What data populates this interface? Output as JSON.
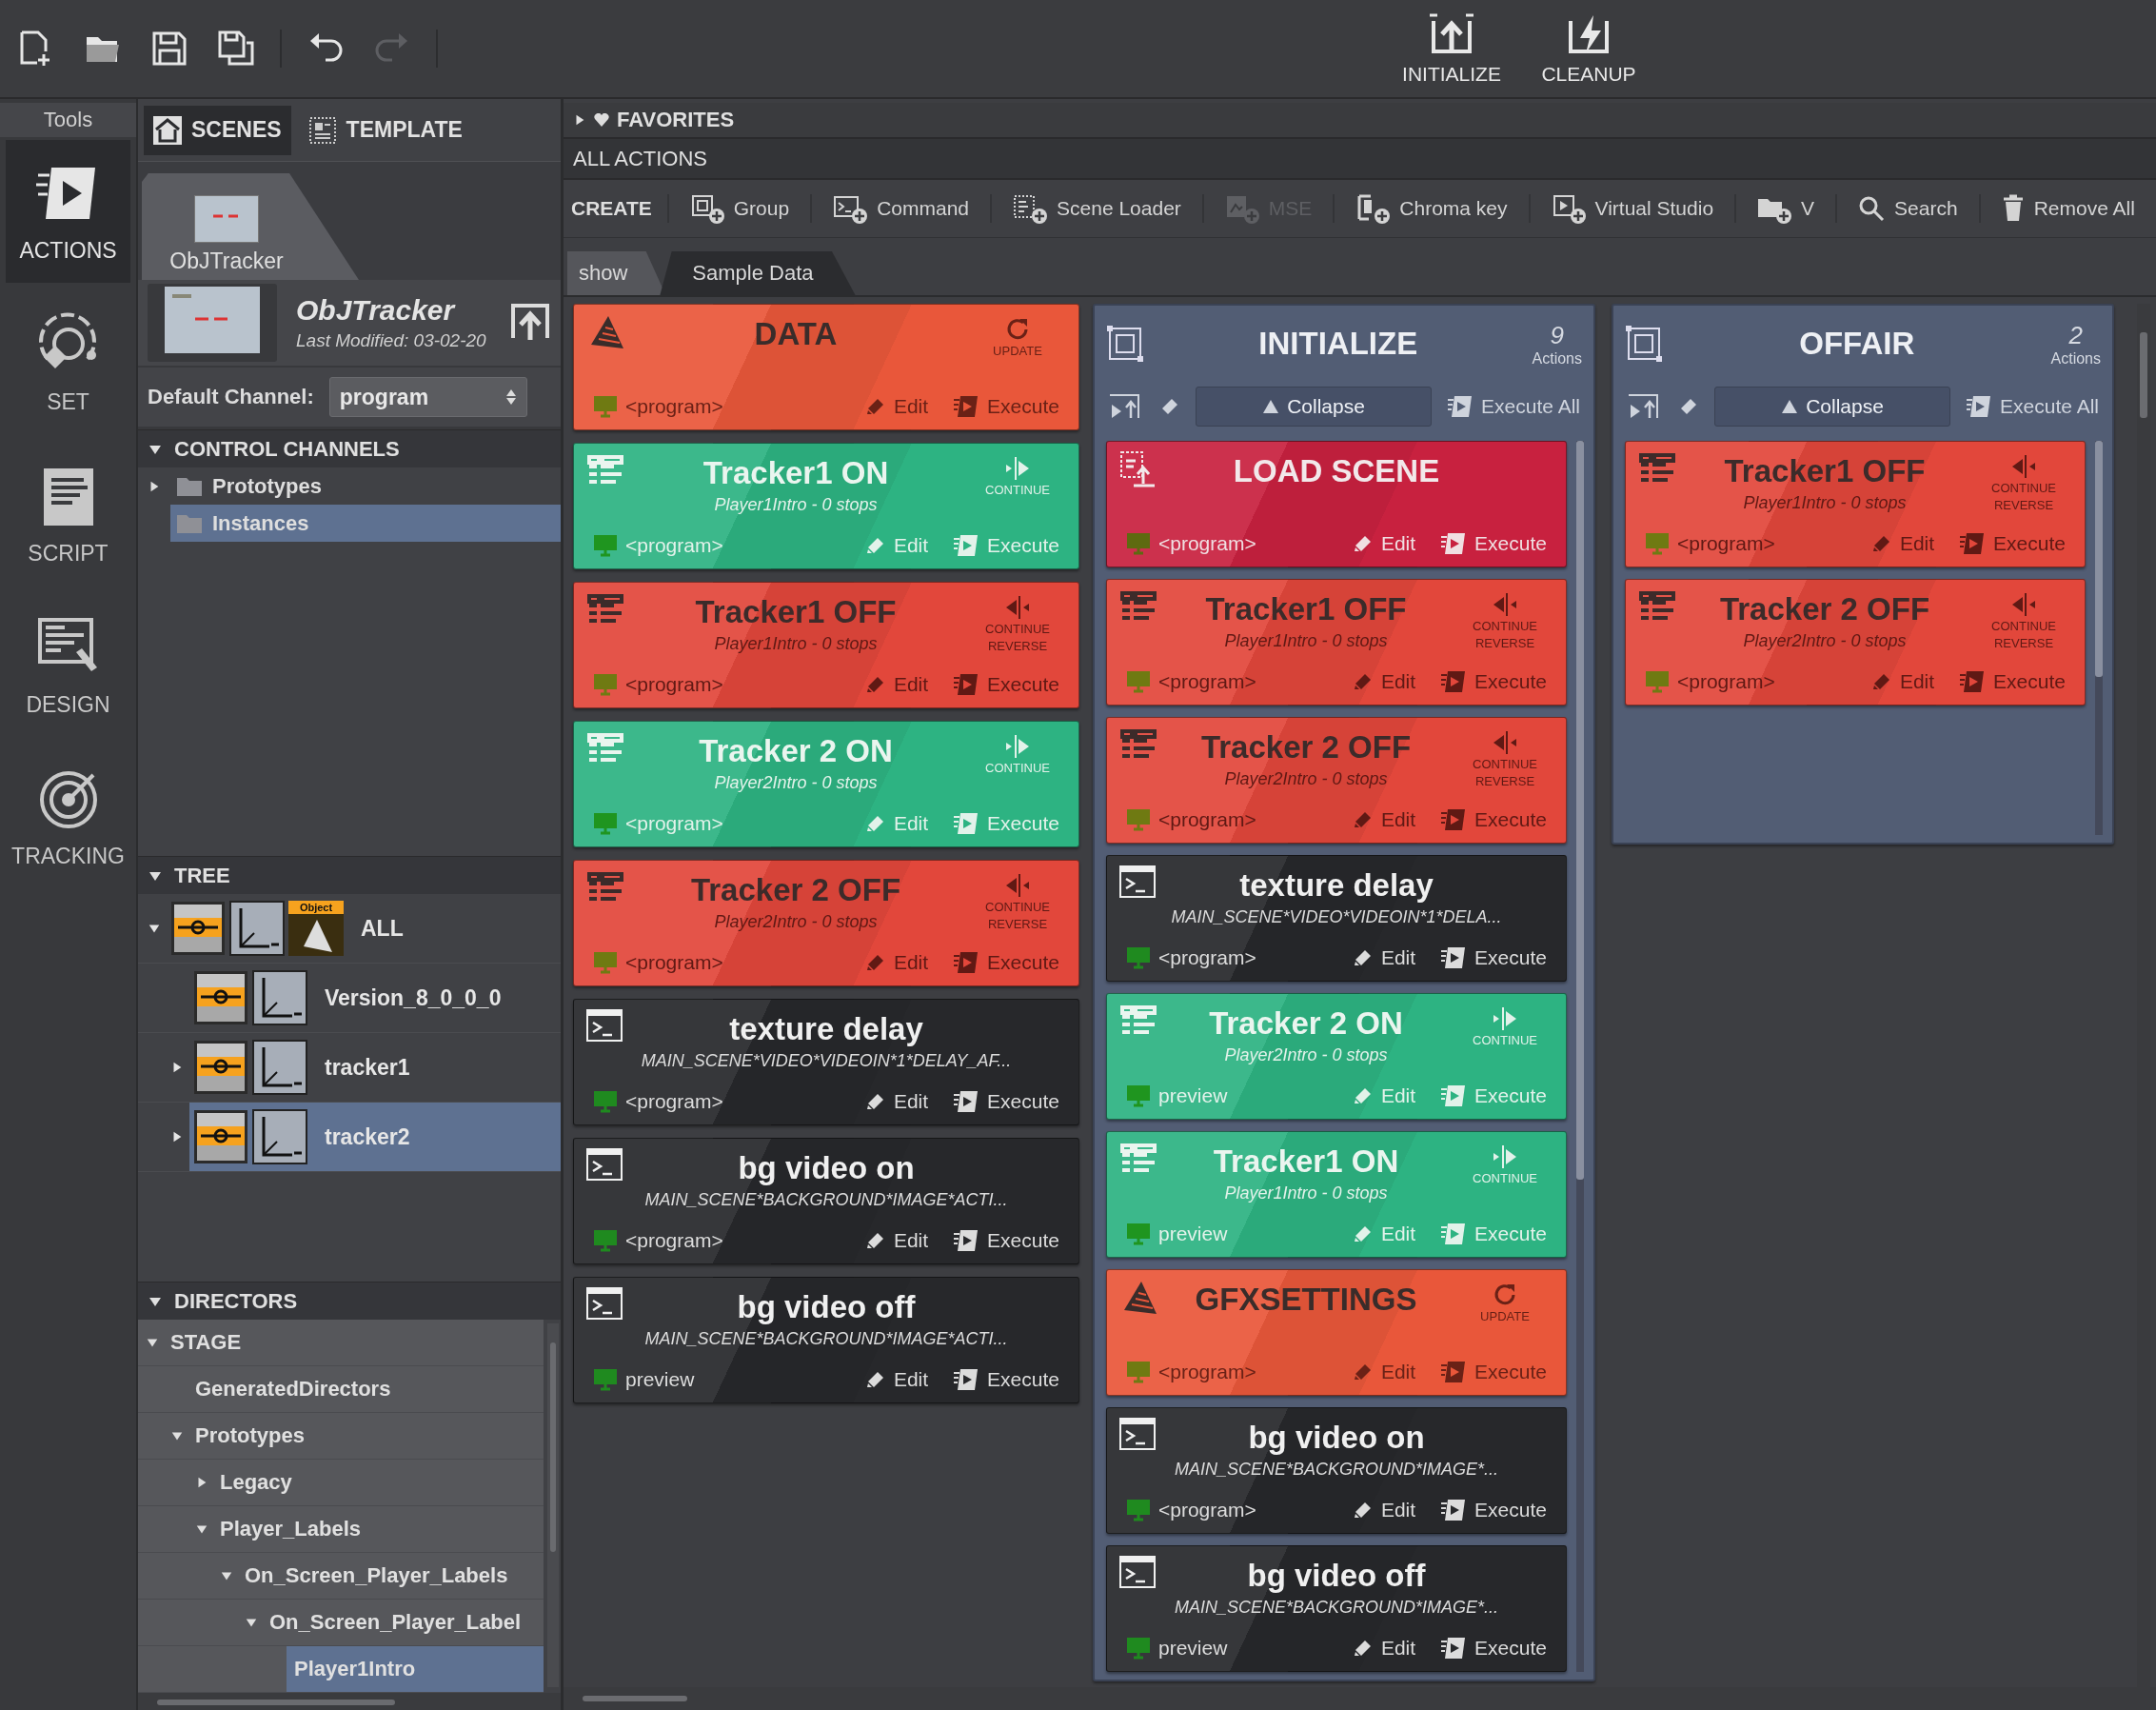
{
  "toolbar": {
    "buttons": [
      {
        "kind": "new",
        "disabled": false
      },
      {
        "kind": "open",
        "disabled": false
      },
      {
        "kind": "save",
        "disabled": false
      },
      {
        "kind": "save_all",
        "disabled": false
      },
      {
        "kind": "undo",
        "disabled": false
      },
      {
        "kind": "redo",
        "disabled": true
      }
    ],
    "actions": [
      {
        "kind": "initialize",
        "label": "INITIALIZE"
      },
      {
        "kind": "cleanup",
        "label": "CLEANUP"
      }
    ]
  },
  "tools": {
    "title": "Tools",
    "items": [
      {
        "kind": "actions",
        "label": "ACTIONS",
        "selected": true
      },
      {
        "kind": "set",
        "label": "SET",
        "selected": false
      },
      {
        "kind": "script",
        "label": "SCRIPT",
        "selected": false
      },
      {
        "kind": "design",
        "label": "DESIGN",
        "selected": false
      },
      {
        "kind": "tracking",
        "label": "TRACKING",
        "selected": false
      }
    ]
  },
  "scenes_panel": {
    "tabs": [
      {
        "kind": "scenes",
        "label": "SCENES",
        "selected": true
      },
      {
        "kind": "template",
        "label": "TEMPLATE",
        "selected": false
      }
    ],
    "scene_tabs": [
      {
        "label": "ObJTracker",
        "selected": true
      }
    ],
    "scene": {
      "name": "ObJTracker",
      "modified": "Last Modified: 03-02-20"
    },
    "default_channel": {
      "label": "Default Channel:",
      "value": "program"
    },
    "control_channels": {
      "title": "CONTROL CHANNELS",
      "expanded": true,
      "items": [
        {
          "label": "Prototypes",
          "expanded": false,
          "selected": false
        },
        {
          "label": "Instances",
          "selected": true
        }
      ]
    },
    "tree": {
      "title": "TREE",
      "expanded": true,
      "items": [
        {
          "label": "ALL",
          "badge": "Object",
          "expanded": true,
          "selected": false,
          "children": [
            {
              "label": "Version_8_0_0_0",
              "selected": false
            },
            {
              "label": "tracker1",
              "expanded": false,
              "selected": false
            },
            {
              "label": "tracker2",
              "expanded": false,
              "selected": true
            }
          ]
        }
      ]
    },
    "directors": {
      "title": "DIRECTORS",
      "expanded": true,
      "items": [
        {
          "label": "STAGE",
          "expanded": true,
          "selected": false,
          "children": [
            {
              "label": "GeneratedDirectors",
              "selected": false
            },
            {
              "label": "Prototypes",
              "expanded": true,
              "selected": false,
              "children": [
                {
                  "label": "Legacy",
                  "expanded": false,
                  "selected": false
                },
                {
                  "label": "Player_Labels",
                  "expanded": true,
                  "selected": false,
                  "children": [
                    {
                      "label": "On_Screen_Player_Labels",
                      "expanded": true,
                      "selected": false,
                      "children": [
                        {
                          "label": "On_Screen_Player_Label",
                          "expanded": true,
                          "selected": false,
                          "children": [
                            {
                              "label": "Player1Intro",
                              "selected": true
                            }
                          ]
                        }
                      ]
                    }
                  ]
                }
              ]
            }
          ]
        }
      ]
    }
  },
  "actions_panel": {
    "favorites": {
      "title": "FAVORITES",
      "expanded": false
    },
    "title": "ALL ACTIONS",
    "create": {
      "label": "CREATE",
      "items": [
        {
          "kind": "group",
          "label": "Group",
          "disabled": false
        },
        {
          "kind": "command",
          "label": "Command",
          "disabled": false
        },
        {
          "kind": "scene_loader",
          "label": "Scene Loader",
          "disabled": false
        },
        {
          "kind": "mse",
          "label": "MSE",
          "disabled": true
        },
        {
          "kind": "chroma",
          "label": "Chroma key",
          "disabled": false
        },
        {
          "kind": "virtual_studio",
          "label": "Virtual Studio",
          "disabled": false
        },
        {
          "kind": "folder",
          "label": "V",
          "disabled": false
        },
        {
          "kind": "search",
          "label": "Search",
          "disabled": false
        },
        {
          "kind": "remove",
          "label": "Remove All",
          "disabled": false
        }
      ]
    },
    "tabs": [
      {
        "label": "show",
        "selected": true
      },
      {
        "label": "Sample Data",
        "selected": false
      }
    ],
    "cards": [
      {
        "kind": "data",
        "title": "DATA",
        "action": "UPDATE",
        "channel": "<program>",
        "edit": "Edit",
        "execute": "Execute"
      },
      {
        "kind": "tracker_on",
        "title": "Tracker1 ON",
        "subtitle": "Player1Intro - 0 stops",
        "action": "CONTINUE",
        "channel": "<program>",
        "edit": "Edit",
        "execute": "Execute"
      },
      {
        "kind": "tracker_off",
        "title": "Tracker1 OFF",
        "subtitle": "Player1Intro - 0 stops",
        "action": "CONTINUE REVERSE",
        "channel": "<program>",
        "edit": "Edit",
        "execute": "Execute"
      },
      {
        "kind": "tracker_on",
        "title": "Tracker 2 ON",
        "subtitle": "Player2Intro - 0 stops",
        "action": "CONTINUE",
        "channel": "<program>",
        "edit": "Edit",
        "execute": "Execute"
      },
      {
        "kind": "tracker_off",
        "title": "Tracker 2 OFF",
        "subtitle": "Player2Intro - 0 stops",
        "action": "CONTINUE REVERSE",
        "channel": "<program>",
        "edit": "Edit",
        "execute": "Execute"
      },
      {
        "kind": "command",
        "title": "texture delay",
        "subtitle": "MAIN_SCENE*VIDEO*VIDEOIN*1*DELAY_AF...",
        "channel": "<program>",
        "edit": "Edit",
        "execute": "Execute"
      },
      {
        "kind": "command",
        "title": "bg video on",
        "subtitle": "MAIN_SCENE*BACKGROUND*IMAGE*ACTI...",
        "channel": "<program>",
        "edit": "Edit",
        "execute": "Execute"
      },
      {
        "kind": "command",
        "title": "bg video off",
        "subtitle": "MAIN_SCENE*BACKGROUND*IMAGE*ACTI...",
        "channel": "preview",
        "edit": "Edit",
        "execute": "Execute"
      }
    ],
    "groups": [
      {
        "title": "INITIALIZE",
        "count": "9",
        "count_label": "Actions",
        "collapse": "Collapse",
        "execute_all": "Execute All",
        "cards": [
          {
            "kind": "load_scene",
            "title": "LOAD SCENE",
            "channel": "<program>",
            "edit": "Edit",
            "execute": "Execute"
          },
          {
            "kind": "tracker_off",
            "title": "Tracker1 OFF",
            "subtitle": "Player1Intro - 0 stops",
            "action": "CONTINUE REVERSE",
            "channel": "<program>",
            "edit": "Edit",
            "execute": "Execute"
          },
          {
            "kind": "tracker_off",
            "title": "Tracker 2 OFF",
            "subtitle": "Player2Intro - 0 stops",
            "action": "CONTINUE REVERSE",
            "channel": "<program>",
            "edit": "Edit",
            "execute": "Execute"
          },
          {
            "kind": "command",
            "title": "texture delay",
            "subtitle": "MAIN_SCENE*VIDEO*VIDEOIN*1*DELA...",
            "channel": "<program>",
            "edit": "Edit",
            "execute": "Execute"
          },
          {
            "kind": "tracker_on",
            "title": "Tracker 2 ON",
            "subtitle": "Player2Intro - 0 stops",
            "action": "CONTINUE",
            "channel": "preview",
            "edit": "Edit",
            "execute": "Execute"
          },
          {
            "kind": "tracker_on",
            "title": "Tracker1 ON",
            "subtitle": "Player1Intro - 0 stops",
            "action": "CONTINUE",
            "channel": "preview",
            "edit": "Edit",
            "execute": "Execute"
          },
          {
            "kind": "data",
            "title": "GFXSETTINGS",
            "action": "UPDATE",
            "channel": "<program>",
            "edit": "Edit",
            "execute": "Execute"
          },
          {
            "kind": "command",
            "title": "bg video on",
            "subtitle": "MAIN_SCENE*BACKGROUND*IMAGE*...",
            "channel": "<program>",
            "edit": "Edit",
            "execute": "Execute"
          },
          {
            "kind": "command",
            "title": "bg video off",
            "subtitle": "MAIN_SCENE*BACKGROUND*IMAGE*...",
            "channel": "preview",
            "edit": "Edit",
            "execute": "Execute"
          }
        ]
      },
      {
        "title": "OFFAIR",
        "count": "2",
        "count_label": "Actions",
        "collapse": "Collapse",
        "execute_all": "Execute All",
        "cards": [
          {
            "kind": "tracker_off",
            "title": "Tracker1 OFF",
            "subtitle": "Player1Intro - 0 stops",
            "action": "CONTINUE REVERSE",
            "channel": "<program>",
            "edit": "Edit",
            "execute": "Execute"
          },
          {
            "kind": "tracker_off",
            "title": "Tracker 2 OFF",
            "subtitle": "Player2Intro - 0 stops",
            "action": "CONTINUE REVERSE",
            "channel": "<program>",
            "edit": "Edit",
            "execute": "Execute"
          }
        ]
      }
    ]
  }
}
